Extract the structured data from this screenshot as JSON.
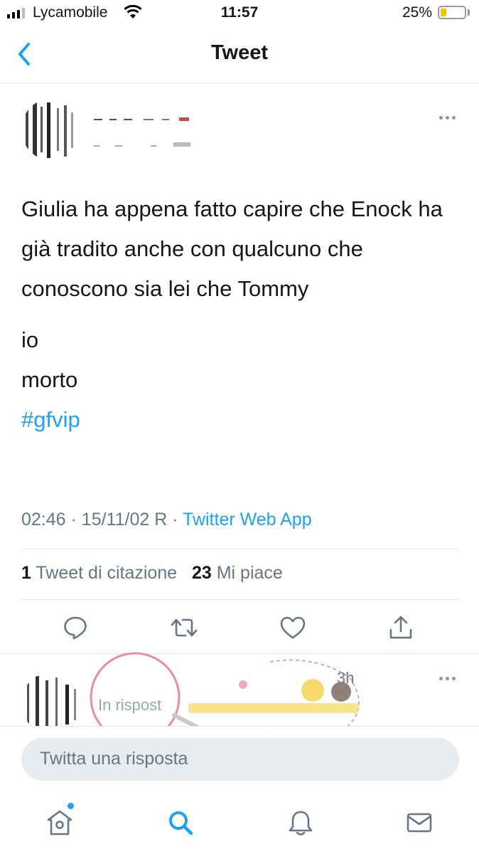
{
  "status_bar": {
    "carrier": "Lycamobile",
    "time": "11:57",
    "battery_percent": "25%",
    "battery_level": 0.25,
    "signal_icon": "cellular-signal-icon",
    "wifi_icon": "wifi-icon"
  },
  "nav": {
    "title": "Tweet",
    "back_icon": "chevron-left-icon"
  },
  "tweet": {
    "lines": [
      "Giulia ha appena fatto capire che Enock ha già tradito anche con qualcuno che conoscono sia lei che Tommy",
      "io",
      "morto"
    ],
    "hashtag": "#gfvip",
    "time": "02:46",
    "date": "15/11/02 R",
    "separator": "·",
    "source": "Twitter Web App",
    "quote_count": "1",
    "quote_label": "Tweet di citazione",
    "like_count": "23",
    "like_label": "Mi piace"
  },
  "actions": [
    "reply-icon",
    "retweet-icon",
    "like-icon",
    "share-icon"
  ],
  "reply": {
    "in_reply_prefix": "In rispost",
    "time": "3h"
  },
  "composer": {
    "placeholder": "Twitta una risposta"
  },
  "tab_bar": [
    "home-icon",
    "search-icon",
    "notifications-icon",
    "messages-icon"
  ],
  "colors": {
    "accent": "#1da1f2",
    "text": "#14171a",
    "secondary": "#657786",
    "divider": "#e1e8ed",
    "battery": "#f5c400"
  }
}
